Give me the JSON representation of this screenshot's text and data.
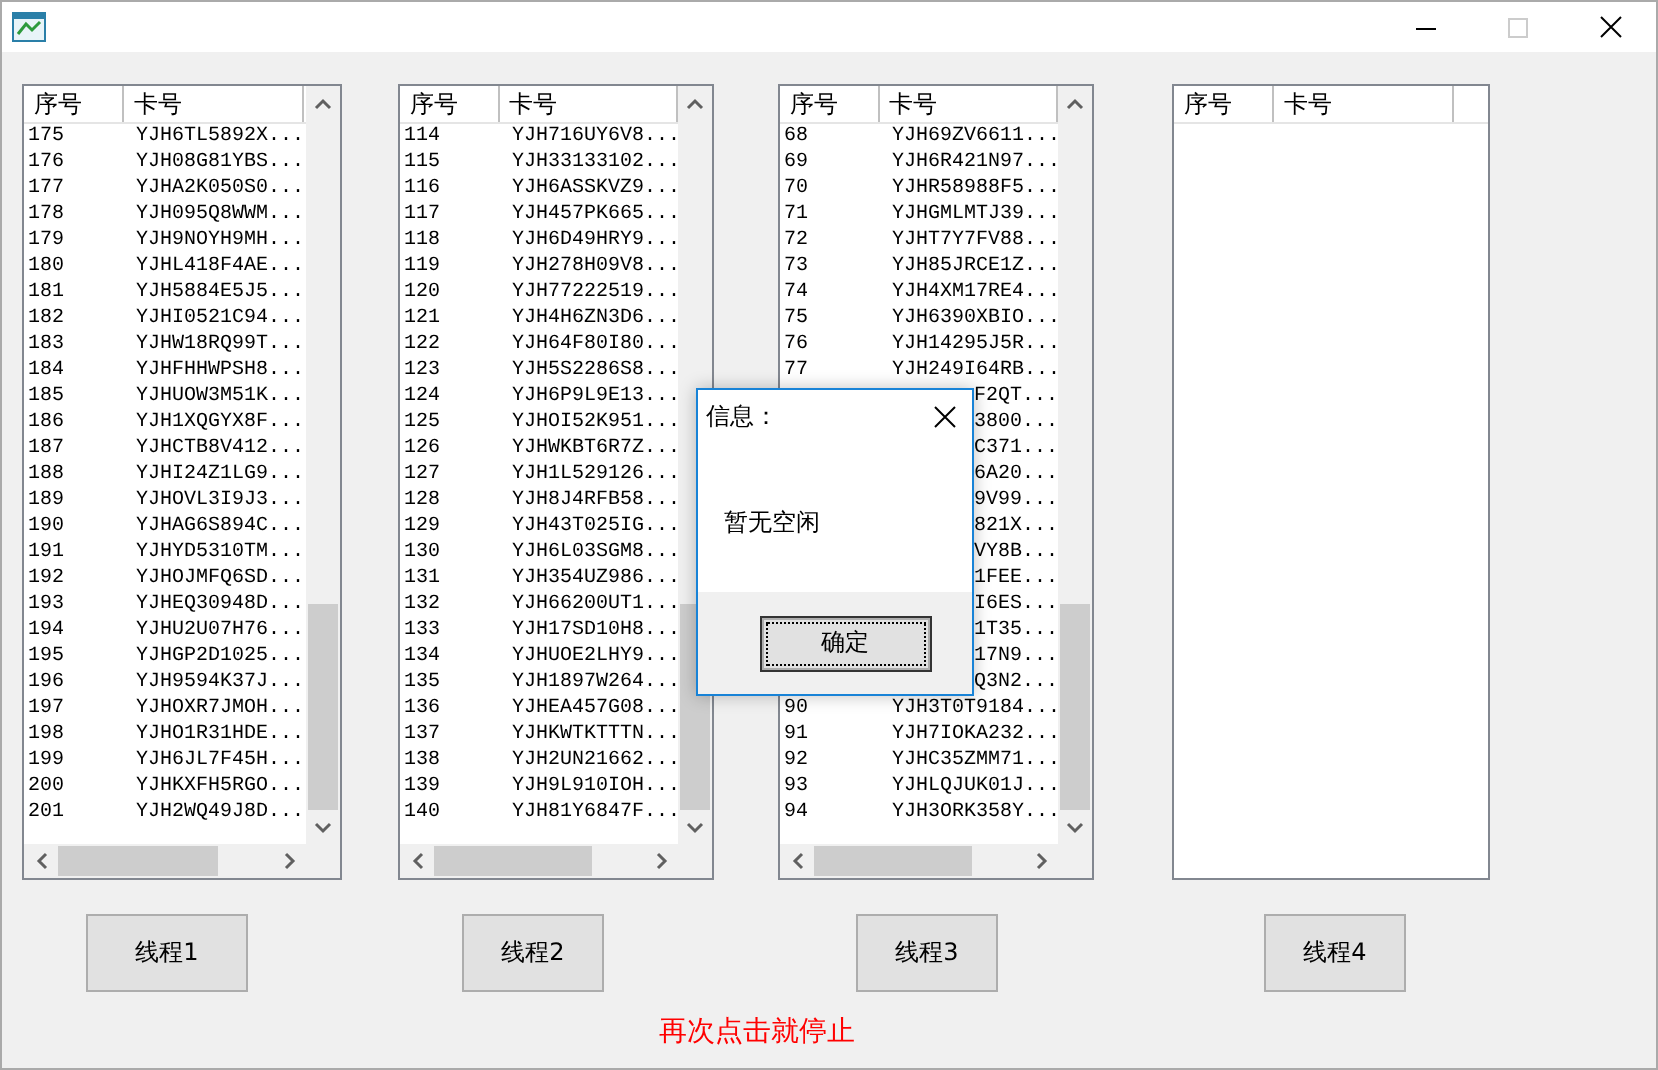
{
  "lists": [
    {
      "columns": [
        "序号",
        "卡号"
      ],
      "scrollbars": true,
      "rows": [
        {
          "no": "175",
          "card": "YJH6TL5892X..."
        },
        {
          "no": "176",
          "card": "YJH08G81YBS..."
        },
        {
          "no": "177",
          "card": "YJHA2K050S0..."
        },
        {
          "no": "178",
          "card": "YJH095Q8WWM..."
        },
        {
          "no": "179",
          "card": "YJH9NOYH9MH..."
        },
        {
          "no": "180",
          "card": "YJHL418F4AE..."
        },
        {
          "no": "181",
          "card": "YJH5884E5J5..."
        },
        {
          "no": "182",
          "card": "YJHI0521C94..."
        },
        {
          "no": "183",
          "card": "YJHW18RQ99T..."
        },
        {
          "no": "184",
          "card": "YJHFHHWPSH8..."
        },
        {
          "no": "185",
          "card": "YJHUOW3M51K..."
        },
        {
          "no": "186",
          "card": "YJH1XQGYX8F..."
        },
        {
          "no": "187",
          "card": "YJHCTB8V412..."
        },
        {
          "no": "188",
          "card": "YJHI24Z1LG9..."
        },
        {
          "no": "189",
          "card": "YJHOVL3I9J3..."
        },
        {
          "no": "190",
          "card": "YJHAG6S894C..."
        },
        {
          "no": "191",
          "card": "YJHYD5310TM..."
        },
        {
          "no": "192",
          "card": "YJHOJMFQ6SD..."
        },
        {
          "no": "193",
          "card": "YJHEQ30948D..."
        },
        {
          "no": "194",
          "card": "YJHU2U07H76..."
        },
        {
          "no": "195",
          "card": "YJHGP2D1025..."
        },
        {
          "no": "196",
          "card": "YJH9594K37J..."
        },
        {
          "no": "197",
          "card": "YJHOXR7JMOH..."
        },
        {
          "no": "198",
          "card": "YJHO1R31HDE..."
        },
        {
          "no": "199",
          "card": "YJH6JL7F45H..."
        },
        {
          "no": "200",
          "card": "YJHKXFH5RGO..."
        },
        {
          "no": "201",
          "card": "YJH2WQ49J8D..."
        }
      ]
    },
    {
      "columns": [
        "序号",
        "卡号"
      ],
      "scrollbars": true,
      "rows": [
        {
          "no": "114",
          "card": "YJH716UY6V8..."
        },
        {
          "no": "115",
          "card": "YJH33133102..."
        },
        {
          "no": "116",
          "card": "YJH6ASSKVZ9..."
        },
        {
          "no": "117",
          "card": "YJH457PK665..."
        },
        {
          "no": "118",
          "card": "YJH6D49HRY9..."
        },
        {
          "no": "119",
          "card": "YJH278H09V8..."
        },
        {
          "no": "120",
          "card": "YJH77222519..."
        },
        {
          "no": "121",
          "card": "YJH4H6ZN3D6..."
        },
        {
          "no": "122",
          "card": "YJH64F80I80..."
        },
        {
          "no": "123",
          "card": "YJH5S2286S8..."
        },
        {
          "no": "124",
          "card": "YJH6P9L9E13..."
        },
        {
          "no": "125",
          "card": "YJHOI52K951..."
        },
        {
          "no": "126",
          "card": "YJHWKBT6R7Z..."
        },
        {
          "no": "127",
          "card": "YJH1L529126..."
        },
        {
          "no": "128",
          "card": "YJH8J4RFB58..."
        },
        {
          "no": "129",
          "card": "YJH43T025IG..."
        },
        {
          "no": "130",
          "card": "YJH6L03SGM8..."
        },
        {
          "no": "131",
          "card": "YJH354UZ986..."
        },
        {
          "no": "132",
          "card": "YJH66200UT1..."
        },
        {
          "no": "133",
          "card": "YJH17SD10H8..."
        },
        {
          "no": "134",
          "card": "YJHUOE2LHY9..."
        },
        {
          "no": "135",
          "card": "YJH1897W264..."
        },
        {
          "no": "136",
          "card": "YJHEA457G08..."
        },
        {
          "no": "137",
          "card": "YJHKWTKTTTN..."
        },
        {
          "no": "138",
          "card": "YJH2UN21662..."
        },
        {
          "no": "139",
          "card": "YJH9L910IOH..."
        },
        {
          "no": "140",
          "card": "YJH81Y6847F..."
        }
      ]
    },
    {
      "columns": [
        "序号",
        "卡号"
      ],
      "scrollbars": true,
      "rows": [
        {
          "no": "68",
          "card": "YJH69ZV6611..."
        },
        {
          "no": "69",
          "card": "YJH6R421N97..."
        },
        {
          "no": "70",
          "card": "YJHR58988F5..."
        },
        {
          "no": "71",
          "card": "YJHGMLMTJ39..."
        },
        {
          "no": "72",
          "card": "YJHT7Y7FV88..."
        },
        {
          "no": "73",
          "card": "YJH85JRCE1Z..."
        },
        {
          "no": "74",
          "card": "YJH4XM17RE4..."
        },
        {
          "no": "75",
          "card": "YJH6390XBIO..."
        },
        {
          "no": "76",
          "card": "YJH14295J5R..."
        },
        {
          "no": "77",
          "card": "YJH249I64RB..."
        },
        {
          "card": "F2QT..."
        },
        {
          "card": "3800..."
        },
        {
          "card": "C371..."
        },
        {
          "card": "6A20..."
        },
        {
          "card": "9V99..."
        },
        {
          "card": "821X..."
        },
        {
          "card": "VY8B..."
        },
        {
          "card": "1FEE..."
        },
        {
          "card": "I6ES..."
        },
        {
          "card": "1T35..."
        },
        {
          "card": "17N9..."
        },
        {
          "card": "Q3N2..."
        },
        {
          "no": "90",
          "card": "YJH3T0T9184..."
        },
        {
          "no": "91",
          "card": "YJH7IOKA232..."
        },
        {
          "no": "92",
          "card": "YJHC35ZMM71..."
        },
        {
          "no": "93",
          "card": "YJHLQJUK01J..."
        },
        {
          "no": "94",
          "card": "YJH3ORK358Y..."
        }
      ]
    },
    {
      "columns": [
        "序号",
        "卡号"
      ],
      "scrollbars": false
    }
  ],
  "buttons": [
    "线程1",
    "线程2",
    "线程3",
    "线程4"
  ],
  "hint": "再次点击就停止",
  "dialog": {
    "title": "信息：",
    "message": "暂无空闲",
    "button": "确定"
  }
}
